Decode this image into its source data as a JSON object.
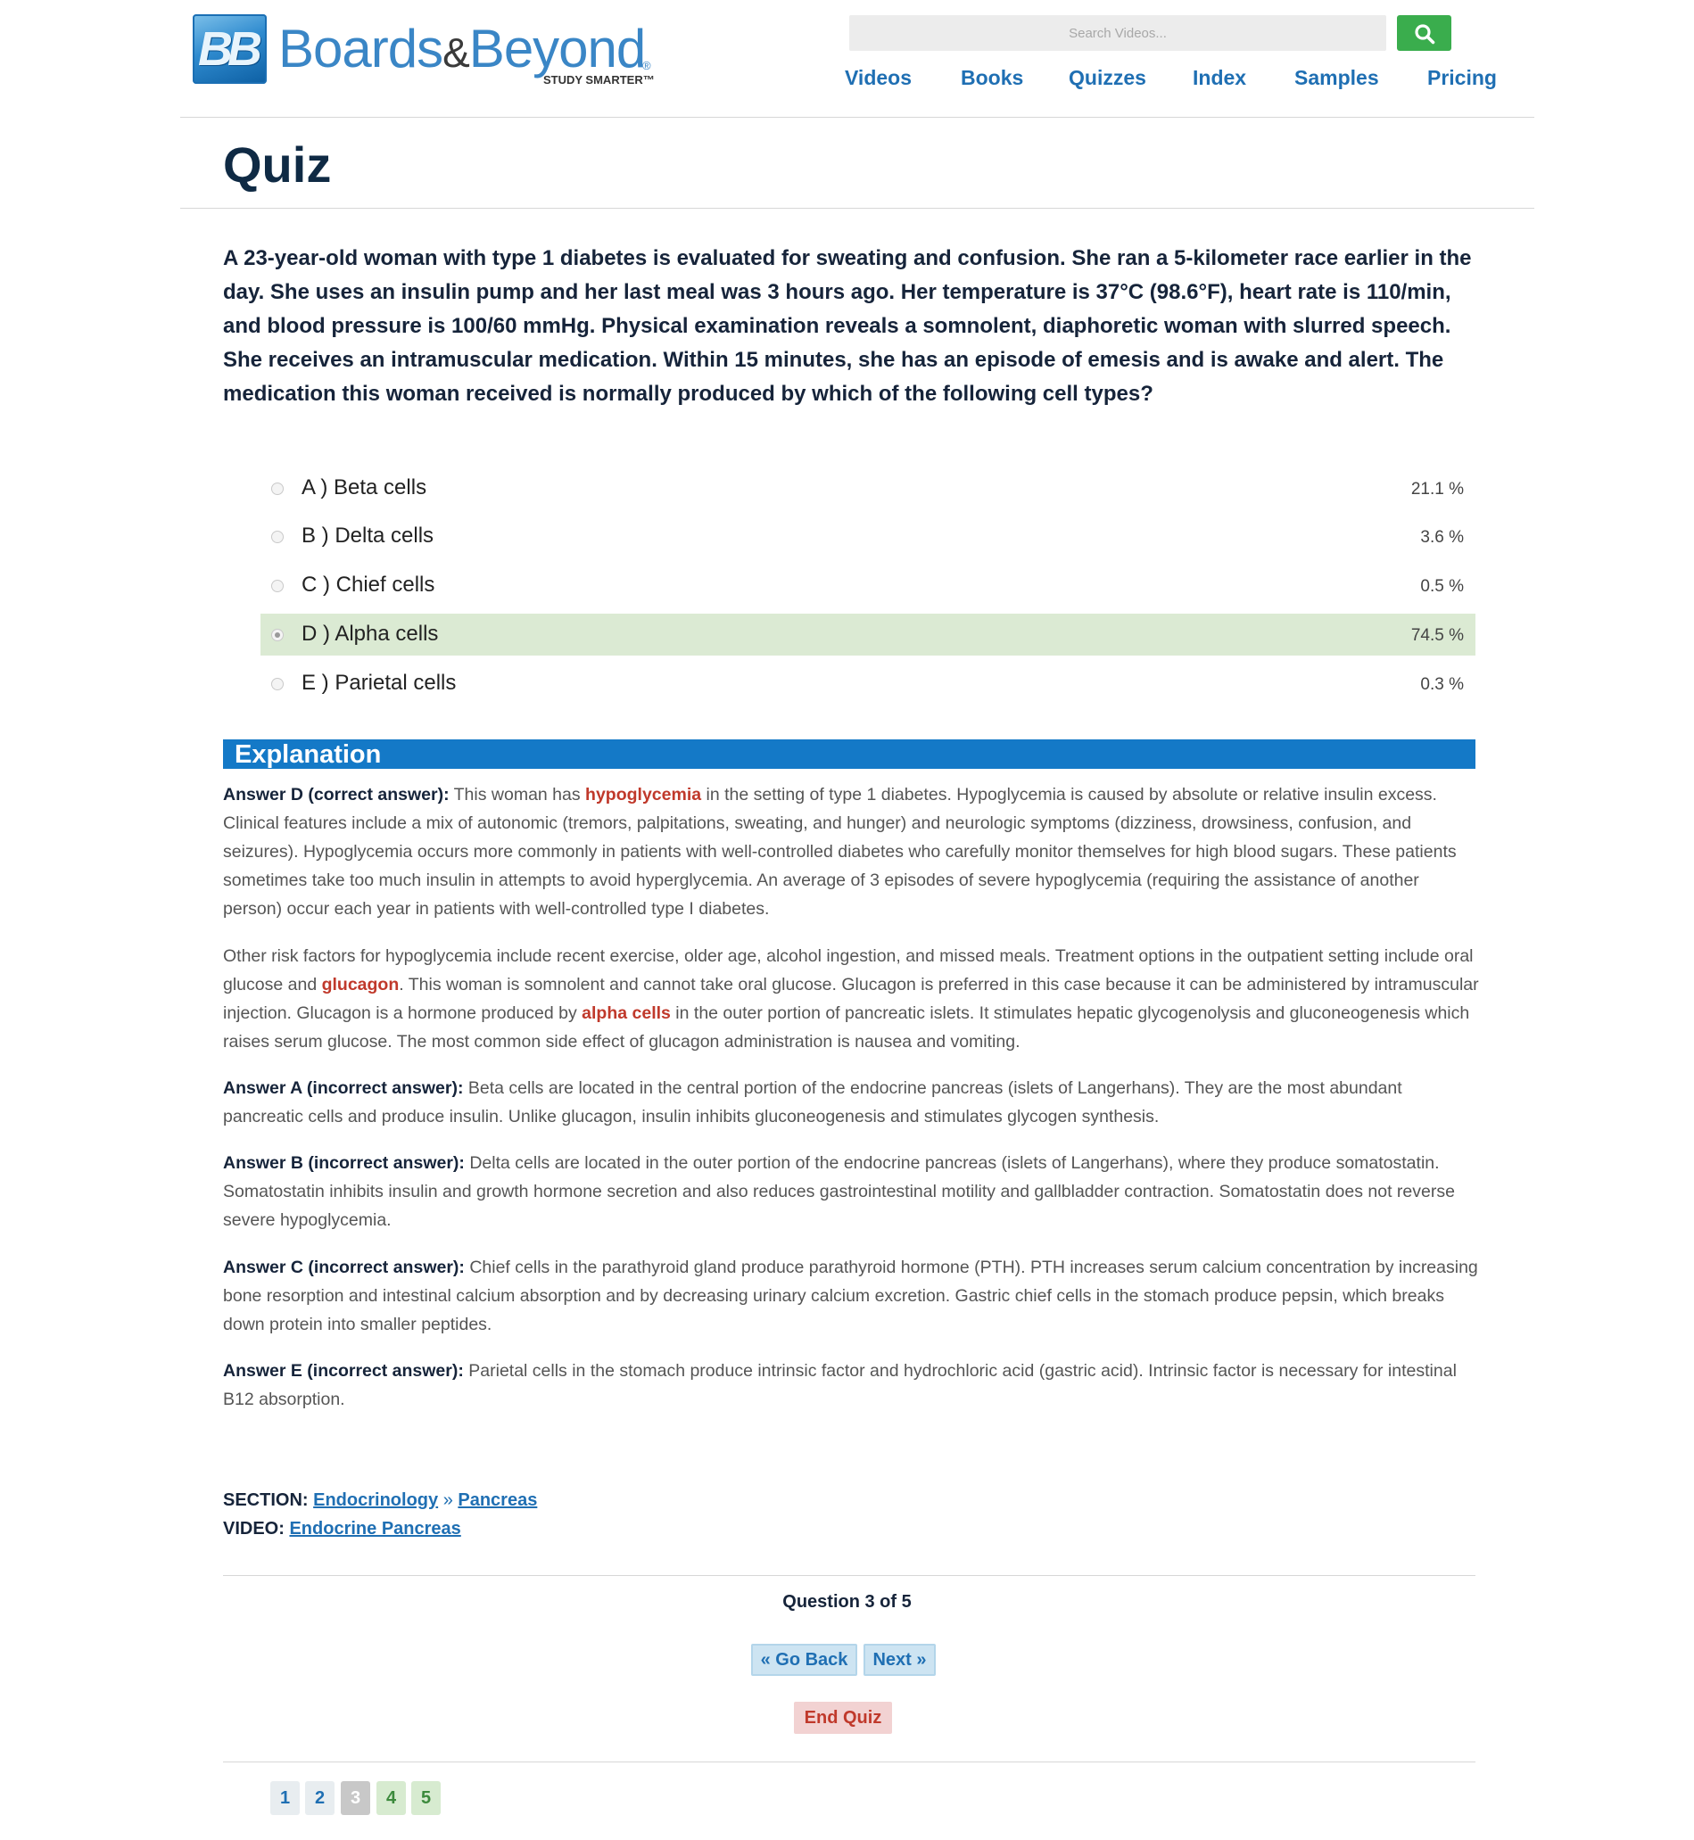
{
  "brand": {
    "badge": "BB",
    "name_part1": "Boards",
    "name_amp": "&",
    "name_part2": "Beyond",
    "registered": "®",
    "tagline": "STUDY SMARTER™",
    "accent": "#1f6fb3"
  },
  "search": {
    "placeholder": "Search Videos...",
    "button_icon": "search-icon",
    "button_color": "#3aad4d"
  },
  "nav": [
    "Videos",
    "Books",
    "Quizzes",
    "Index",
    "Samples",
    "Pricing"
  ],
  "page_title": "Quiz",
  "question": "A 23-year-old woman with type 1 diabetes is evaluated for sweating and confusion. She ran a 5-kilometer race earlier in the day. She uses an insulin pump and her last meal was 3 hours ago. Her temperature is 37°C (98.6°F), heart rate is 110/min, and blood pressure is 100/60 mmHg. Physical examination reveals a somnolent, diaphoretic woman with slurred speech. She receives an intramuscular medication. Within 15 minutes, she has an episode of emesis and is awake and alert. The medication this woman received is normally produced by which of the following cell types?",
  "choices": [
    {
      "label": "A ) Beta cells",
      "percent": "21.1 %"
    },
    {
      "label": "B ) Delta cells",
      "percent": "3.6 %"
    },
    {
      "label": "C ) Chief cells",
      "percent": "0.5 %"
    },
    {
      "label": "D ) Alpha cells",
      "percent": "74.5 %",
      "correct": true,
      "selected": true
    },
    {
      "label": "E ) Parietal cells",
      "percent": "0.3 %"
    }
  ],
  "explanation": {
    "heading": "Explanation",
    "answer_d": {
      "lead": "Answer D (correct answer):",
      "t1": " This woman has ",
      "hl1": "hypoglycemia",
      "t2": " in the setting of type 1 diabetes. Hypoglycemia is caused by absolute or relative insulin excess. Clinical features include a mix of autonomic (tremors, palpitations, sweating, and hunger) and neurologic symptoms (dizziness, drowsiness, confusion, and seizures). Hypoglycemia occurs more commonly in patients with well-controlled diabetes who carefully monitor themselves for high blood sugars. These patients sometimes take too much insulin in attempts to avoid hyperglycemia. An average of 3 episodes of severe hypoglycemia (requiring the assistance of another person) occur each year in patients with well-controlled type I diabetes."
    },
    "risk": {
      "t1": "Other risk factors for hypoglycemia include recent exercise, older age, alcohol ingestion, and missed meals. Treatment options in the outpatient setting include oral glucose and ",
      "hl1": "glucagon",
      "t2": ". This woman is somnolent and cannot take oral glucose. Glucagon is preferred in this case because it can be administered by intramuscular injection. Glucagon is a hormone produced by ",
      "hl2": "alpha cells",
      "t3": " in the outer portion of pancreatic islets. It stimulates hepatic glycogenolysis and gluconeogenesis which raises serum glucose. The most common side effect of glucagon administration is nausea and vomiting."
    },
    "answer_a": {
      "lead": "Answer A (incorrect answer):",
      "text": " Beta cells are located in the central portion of the endocrine pancreas (islets of Langerhans). They are the most abundant pancreatic cells and produce insulin. Unlike glucagon, insulin inhibits gluconeogenesis and stimulates glycogen synthesis."
    },
    "answer_b": {
      "lead": "Answer B (incorrect answer):",
      "text": " Delta cells are located in the outer portion of the endocrine pancreas (islets of Langerhans), where they produce somatostatin. Somatostatin inhibits insulin and growth hormone secretion and also reduces gastrointestinal motility and gallbladder contraction. Somatostatin does not reverse severe hypoglycemia."
    },
    "answer_c": {
      "lead": "Answer C (incorrect answer):",
      "text": " Chief cells in the parathyroid gland produce parathyroid hormone (PTH). PTH increases serum calcium concentration by increasing bone resorption and intestinal calcium absorption and by decreasing urinary calcium excretion. Gastric chief cells in the stomach produce pepsin, which breaks down protein into smaller peptides."
    },
    "answer_e": {
      "lead": "Answer E (incorrect answer):",
      "text": " Parietal cells in the stomach produce intrinsic factor and hydrochloric acid (gastric acid). Intrinsic factor is necessary for intestinal B12 absorption."
    }
  },
  "section": {
    "label": "SECTION:",
    "link1": "Endocrinology",
    "separator": "»",
    "link2": "Pancreas"
  },
  "video": {
    "label": "VIDEO:",
    "link": "Endocrine Pancreas"
  },
  "progress": {
    "text": "Question 3 of 5",
    "current": 3,
    "total": 5
  },
  "buttons": {
    "back": "« Go Back",
    "next": "Next »",
    "end": "End Quiz"
  },
  "pages": [
    "1",
    "2",
    "3",
    "4",
    "5"
  ],
  "colors": {
    "correct_bg": "#dbead3",
    "explanation_bar": "#1479c7",
    "highlight": "#c0392b",
    "end_quiz_bg": "#f2d2d2"
  }
}
